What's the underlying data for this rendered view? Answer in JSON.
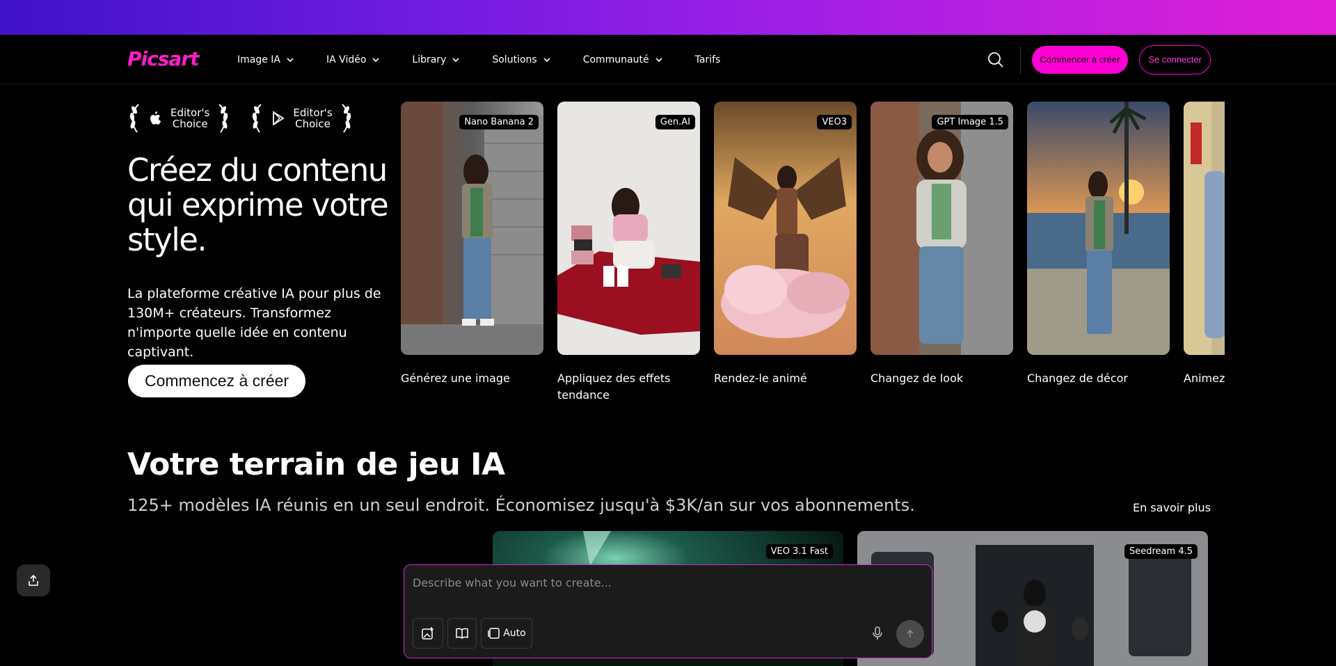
{
  "brand": {
    "logo": "Picsart",
    "accent": "#ff00d4"
  },
  "nav": {
    "items": [
      {
        "label": "Image IA",
        "has_dropdown": true
      },
      {
        "label": "IA Vidéo",
        "has_dropdown": true
      },
      {
        "label": "Library",
        "has_dropdown": true
      },
      {
        "label": "Solutions",
        "has_dropdown": true
      },
      {
        "label": "Communauté",
        "has_dropdown": true
      },
      {
        "label": "Tarifs",
        "has_dropdown": false
      }
    ],
    "search_icon": "search-icon",
    "create_label": "Commencer à créer",
    "login_label": "Se connecter"
  },
  "awards": [
    {
      "icon": "apple-icon",
      "line1": "Editor's",
      "line2": "Choice"
    },
    {
      "icon": "play-store-icon",
      "line1": "Editor's",
      "line2": "Choice"
    }
  ],
  "hero": {
    "title": "Créez du contenu qui exprime votre style.",
    "description": "La plateforme créative IA pour plus de 130M+ créateurs. Transformez n'importe quelle idée en contenu captivant.",
    "cta": "Commencez à créer"
  },
  "cards": [
    {
      "badge": "Nano Banana 2",
      "label": "Générez une image"
    },
    {
      "badge": "Gen.AI",
      "label": "Appliquez des effets tendance"
    },
    {
      "badge": "VEO3",
      "label": "Rendez-le animé"
    },
    {
      "badge": "GPT Image 1.5",
      "label": "Changez de look"
    },
    {
      "badge": "",
      "label": "Changez de décor"
    },
    {
      "badge": "",
      "label": "Animez-"
    }
  ],
  "playground": {
    "title": "Votre terrain de jeu IA",
    "subtitle": "125+ modèles IA réunis en un seul endroit. Économisez jusqu'à $3K/an sur vos abonnements.",
    "learn_more": "En savoir plus",
    "media": [
      {
        "badge": "VEO 3.1 Fast"
      },
      {
        "badge": "Seedream 4.5"
      }
    ]
  },
  "prompt": {
    "placeholder": "Describe what you want to create...",
    "aspect_label": "Auto"
  }
}
